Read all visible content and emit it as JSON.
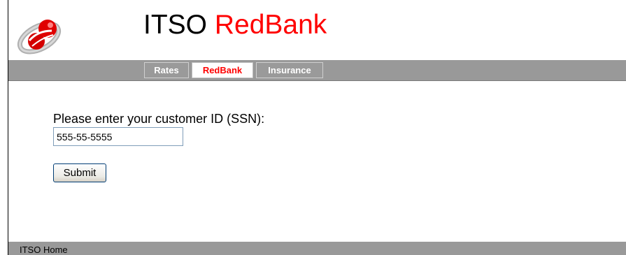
{
  "header": {
    "brand_prefix": "ITSO",
    "brand_highlight": "RedBank"
  },
  "nav": {
    "tabs": [
      {
        "label": "Rates",
        "active": false
      },
      {
        "label": "RedBank",
        "active": true
      },
      {
        "label": "Insurance",
        "active": false
      }
    ]
  },
  "form": {
    "prompt": "Please enter your customer ID (SSN):",
    "ssn_value": "555-55-5555",
    "submit_label": "Submit"
  },
  "footer": {
    "home_link": "ITSO Home"
  },
  "colors": {
    "brand_red": "#ff0000",
    "nav_gray": "#999999"
  }
}
